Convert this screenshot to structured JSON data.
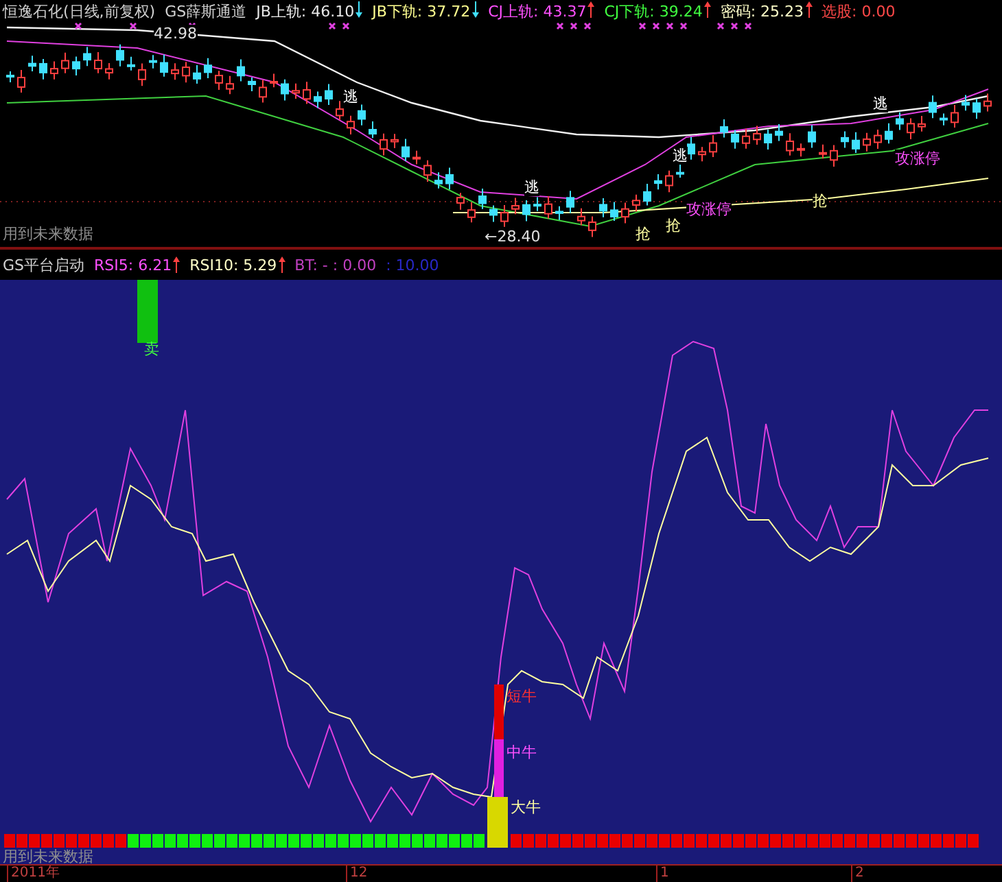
{
  "title": "恒逸石化(日线,前复权)",
  "main_indicator": {
    "name": "GS薛斯通道",
    "values": [
      {
        "label": "JB上轨:",
        "value": "46.10",
        "kind": "falling",
        "color": "#e8e8e8"
      },
      {
        "label": "JB下轨:",
        "value": "37.72",
        "kind": "falling",
        "color": "#ffff90"
      },
      {
        "label": "CJ上轨:",
        "value": "43.37",
        "kind": "rising",
        "color": "#ff50ff"
      },
      {
        "label": "CJ下轨:",
        "value": "39.24",
        "kind": "rising",
        "color": "#40ff40"
      },
      {
        "label": "密码:",
        "value": "25.23",
        "kind": "rising",
        "color": "#ffffc8"
      },
      {
        "label": "选股:",
        "value": "0.00",
        "kind": "plain",
        "color": "#ff4848"
      }
    ]
  },
  "price_chart": {
    "labels": [
      {
        "text": "42.98",
        "kind": "price"
      },
      {
        "text": "逃",
        "kind": "escape"
      },
      {
        "text": "逃",
        "kind": "escape"
      },
      {
        "text": "攻涨停",
        "kind": "limit"
      },
      {
        "text": "抢",
        "kind": "grab"
      },
      {
        "text": "抢",
        "kind": "grab"
      },
      {
        "text": "逃",
        "kind": "escape"
      },
      {
        "text": "←28.40",
        "kind": "price"
      },
      {
        "text": "抢",
        "kind": "grab"
      },
      {
        "text": "逃",
        "kind": "escape"
      },
      {
        "text": "攻涨停",
        "kind": "limit"
      },
      {
        "text": "用到未来数据",
        "kind": "note"
      }
    ]
  },
  "sub_indicator": {
    "name": "GS平台启动",
    "values": [
      {
        "label": "RSI5:",
        "value": "6.21",
        "kind": "rising",
        "color": "#ff50ff"
      },
      {
        "label": "RSI10:",
        "value": "5.29",
        "kind": "rising",
        "color": "#ffffc8"
      },
      {
        "label": "BT:",
        "value": "- : 0.00",
        "kind": "plain",
        "color": "#c040c0"
      },
      {
        "value": ": 10.00",
        "kind": "plain",
        "color": "#2828c8"
      }
    ]
  },
  "signal_chart": {
    "labels": [
      {
        "text": "卖",
        "kind": "sell"
      },
      {
        "text": "短牛",
        "kind": "short"
      },
      {
        "text": "中牛",
        "kind": "mid"
      },
      {
        "text": "大牛",
        "kind": "big"
      },
      {
        "text": "用到未来数据",
        "kind": "note"
      }
    ]
  },
  "time_axis": [
    "2011年",
    "12",
    "1",
    "2"
  ]
}
